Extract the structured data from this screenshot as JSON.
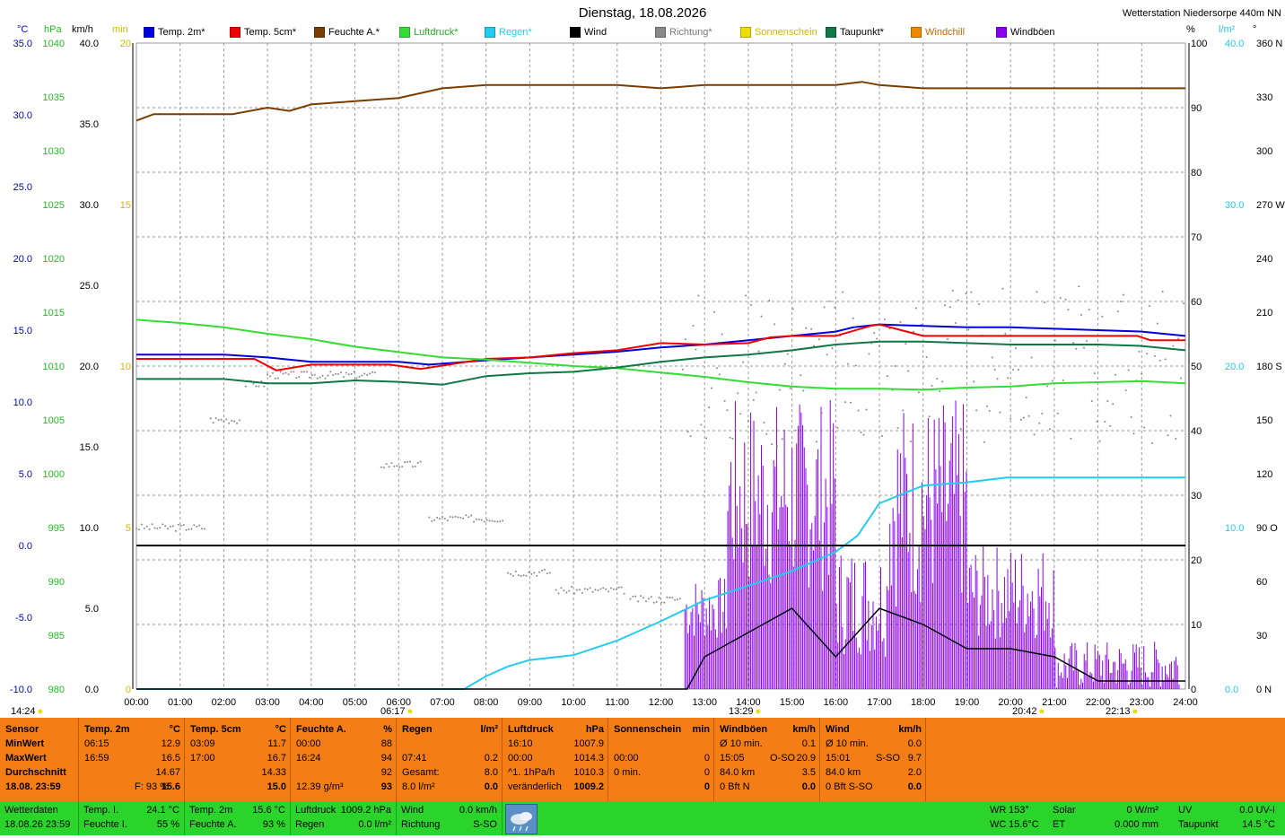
{
  "header": {
    "title": "Dienstag, 18.08.2026",
    "station": "Wetterstation Niedersorpe 440m NN"
  },
  "units": {
    "left": [
      "°C",
      "hPa",
      "km/h",
      "min"
    ],
    "right": [
      "%",
      "l/m²",
      "°"
    ]
  },
  "legend": [
    {
      "label": "Temp. 2m*",
      "color": "#0000dd"
    },
    {
      "label": "Temp. 5cm*",
      "color": "#ee0000"
    },
    {
      "label": "Feuchte A.*",
      "color": "#7a3d00"
    },
    {
      "label": "Luftdruck*",
      "color": "#33dd33"
    },
    {
      "label": "Regen*",
      "color": "#22ccee"
    },
    {
      "label": "Wind",
      "color": "#000000"
    },
    {
      "label": "Richtung*",
      "color": "#888888"
    },
    {
      "label": "Sonnenschein",
      "color": "#eedd00"
    },
    {
      "label": "Taupunkt*",
      "color": "#117744"
    },
    {
      "label": "Windchill",
      "color": "#ee8800"
    },
    {
      "label": "Windböen",
      "color": "#8800ee"
    }
  ],
  "axes": {
    "temp_ticks": [
      "35.0",
      "30.0",
      "25.0",
      "20.0",
      "15.0",
      "10.0",
      "5.0",
      "0.0",
      "-5.0",
      "-10.0"
    ],
    "hpa_ticks": [
      "1040",
      "1035",
      "1030",
      "1025",
      "1020",
      "1015",
      "1010",
      "1005",
      "1000",
      "995",
      "990",
      "985",
      "980"
    ],
    "kmh_ticks": [
      "40.0",
      "35.0",
      "30.0",
      "25.0",
      "20.0",
      "15.0",
      "10.0",
      "5.0",
      "0.0"
    ],
    "min_ticks": [
      "20",
      "15",
      "10",
      "5",
      "0"
    ],
    "pct_ticks": [
      "100",
      "90",
      "80",
      "70",
      "60",
      "50",
      "40",
      "30",
      "20",
      "10",
      "0"
    ],
    "rain_ticks": [
      "40.0",
      "30.0",
      "20.0",
      "10.0",
      "0.0"
    ],
    "deg_ticks": [
      "360 N",
      "330",
      "300",
      "270 W",
      "240",
      "210",
      "180 S",
      "150",
      "120",
      "90 O",
      "60",
      "30",
      "0 N"
    ],
    "time_ticks": [
      "00:00",
      "01:00",
      "02:00",
      "03:00",
      "04:00",
      "05:00",
      "06:00",
      "07:00",
      "08:00",
      "09:00",
      "10:00",
      "11:00",
      "12:00",
      "13:00",
      "14:00",
      "15:00",
      "16:00",
      "17:00",
      "18:00",
      "19:00",
      "20:00",
      "21:00",
      "22:00",
      "23:00",
      "24:00"
    ]
  },
  "markers": [
    {
      "label": "14:24",
      "color": "#eedd00"
    },
    {
      "label": "06:17",
      "color": "#eedd00"
    },
    {
      "label": "13:29",
      "color": "#eedd00"
    },
    {
      "label": "20:42",
      "color": "#eedd00"
    },
    {
      "label": "22:13",
      "color": "#eedd00"
    }
  ],
  "chart_data": {
    "type": "line",
    "x_unit": "hours",
    "series": [
      {
        "name": "Temp. 2m*",
        "unit": "°C",
        "x": [
          0,
          2,
          3,
          4,
          5,
          6,
          6.7,
          8,
          9,
          10,
          11,
          12,
          13,
          14,
          15,
          16,
          16.4,
          17,
          18,
          19,
          20,
          21,
          22,
          23,
          24
        ],
        "y": [
          13.3,
          13.3,
          13.1,
          12.8,
          12.8,
          12.8,
          12.6,
          12.9,
          13.1,
          13.3,
          13.5,
          13.8,
          14.0,
          14.3,
          14.6,
          14.9,
          15.2,
          15.4,
          15.3,
          15.2,
          15.2,
          15.1,
          15.0,
          14.9,
          14.6
        ]
      },
      {
        "name": "Temp. 5cm*",
        "unit": "°C",
        "x": [
          0,
          2.7,
          3.2,
          4,
          5.8,
          6.5,
          8,
          9,
          10,
          11,
          12,
          13,
          14,
          14.5,
          15,
          16,
          16.8,
          17,
          18,
          19,
          20,
          21,
          22,
          22.9,
          23.2,
          24
        ],
        "y": [
          13.0,
          13.0,
          12.2,
          12.6,
          12.6,
          12.3,
          13.0,
          13.1,
          13.4,
          13.6,
          14.1,
          14.0,
          14.1,
          14.5,
          14.6,
          14.6,
          15.3,
          15.4,
          14.6,
          14.6,
          14.6,
          14.6,
          14.6,
          14.6,
          14.3,
          14.3
        ]
      },
      {
        "name": "Feuchte A.*",
        "unit": "%",
        "x": [
          0,
          0.4,
          2.2,
          3,
          3.5,
          4,
          5,
          6,
          7,
          8,
          9,
          10,
          11,
          12,
          13,
          14,
          15,
          16,
          16.6,
          17,
          18,
          19,
          20,
          21,
          22,
          23,
          24
        ],
        "y": [
          88,
          89,
          89,
          90,
          89.5,
          90.5,
          91,
          91.5,
          93,
          93.5,
          93.5,
          93.5,
          93.5,
          93,
          93.5,
          93.5,
          93.5,
          93.5,
          94,
          93.5,
          93,
          93,
          93,
          93,
          93,
          93,
          93
        ]
      },
      {
        "name": "Luftdruck*",
        "unit": "hPa",
        "x": [
          0,
          1,
          2,
          3,
          4,
          5,
          6,
          7,
          8,
          9,
          10,
          11,
          12,
          13,
          14,
          15,
          16,
          17,
          18,
          19,
          20,
          21,
          22,
          23,
          24
        ],
        "y": [
          1014.3,
          1014.0,
          1013.6,
          1013.0,
          1012.5,
          1011.8,
          1011.3,
          1010.8,
          1010.6,
          1010.3,
          1010.0,
          1009.8,
          1009.4,
          1009.0,
          1008.5,
          1008.1,
          1007.9,
          1007.9,
          1007.8,
          1008.0,
          1008.1,
          1008.4,
          1008.5,
          1008.6,
          1008.4
        ]
      },
      {
        "name": "Regen*",
        "unit": "l/m²",
        "x": [
          0,
          7.5,
          8,
          8.5,
          9,
          10,
          11,
          12,
          13,
          14,
          15,
          16,
          16.5,
          17,
          18,
          19,
          19.9,
          20,
          21,
          22,
          23,
          24
        ],
        "y": [
          0,
          0,
          0.8,
          1.4,
          1.8,
          2.1,
          3.0,
          4.2,
          5.5,
          6.4,
          7.3,
          8.5,
          9.5,
          11.5,
          12.6,
          12.8,
          13.1,
          13.1,
          13.1,
          13.1,
          13.1,
          13.1
        ]
      },
      {
        "name": "Wind",
        "unit": "km/h",
        "x": [
          0,
          12.6,
          13,
          14,
          15,
          16,
          17,
          18,
          19,
          20,
          21,
          22,
          23,
          24
        ],
        "y": [
          0,
          0,
          2.0,
          3.5,
          5.0,
          2.0,
          5.0,
          4.0,
          2.5,
          2.5,
          2.0,
          0.5,
          0.5,
          0.5
        ]
      },
      {
        "name": "Taupunkt*",
        "unit": "°C",
        "x": [
          0,
          2,
          3,
          4,
          5,
          6,
          7,
          8,
          9,
          10,
          11,
          12,
          13,
          14,
          15,
          16,
          17,
          18,
          19,
          20,
          21,
          22,
          23,
          24
        ],
        "y": [
          11.6,
          11.6,
          11.3,
          11.3,
          11.5,
          11.4,
          11.2,
          11.8,
          12.0,
          12.1,
          12.4,
          12.8,
          13.1,
          13.3,
          13.6,
          14.0,
          14.2,
          14.2,
          14.1,
          14.0,
          14.0,
          14.0,
          13.9,
          13.6
        ]
      }
    ]
  },
  "table": {
    "columns": [
      {
        "title": "Sensor",
        "unit": "",
        "rows": [
          [
            "MinWert",
            "",
            ""
          ],
          [
            "MaxWert",
            "",
            ""
          ],
          [
            "Durchschnitt",
            "",
            ""
          ],
          [
            "18.08. 23:59",
            "",
            ""
          ]
        ]
      },
      {
        "title": "Temp. 2m",
        "unit": "°C",
        "rows": [
          [
            "06:15",
            "",
            "12.9"
          ],
          [
            "16:59",
            "",
            "16.5"
          ],
          [
            "",
            "",
            "14.67"
          ],
          [
            "",
            "F: 93 %",
            "15.6"
          ]
        ]
      },
      {
        "title": "Temp. 5cm",
        "unit": "°C",
        "rows": [
          [
            "03:09",
            "",
            "11.7"
          ],
          [
            "17:00",
            "",
            "16.7"
          ],
          [
            "",
            "",
            "14.33"
          ],
          [
            "",
            "",
            "15.0"
          ]
        ]
      },
      {
        "title": "Feuchte A.",
        "unit": "%",
        "rows": [
          [
            "00:00",
            "",
            "88"
          ],
          [
            "16:24",
            "",
            "94"
          ],
          [
            "",
            "",
            "92"
          ],
          [
            "12.39 g/m³",
            "",
            "93"
          ]
        ]
      },
      {
        "title": "Regen",
        "unit": "l/m²",
        "rows": [
          [
            "",
            "",
            ""
          ],
          [
            "07:41",
            "",
            "0.2"
          ],
          [
            "Gesamt:",
            "",
            "8.0"
          ],
          [
            "8.0 l/m²",
            "",
            "0.0"
          ]
        ]
      },
      {
        "title": "Luftdruck",
        "unit": "hPa",
        "rows": [
          [
            "16:10",
            "",
            "1007.9"
          ],
          [
            "00:00",
            "",
            "1014.3"
          ],
          [
            "^1. 1hPa/h",
            "",
            "1010.3"
          ],
          [
            "veränderlich",
            "",
            "1009.2"
          ]
        ]
      },
      {
        "title": "Sonnenschein",
        "unit": "min",
        "rows": [
          [
            "",
            "",
            ""
          ],
          [
            "00:00",
            "",
            "0"
          ],
          [
            "0 min.",
            "",
            "0"
          ],
          [
            "",
            "",
            "0"
          ]
        ]
      },
      {
        "title": "Windböen",
        "unit": "km/h",
        "rows": [
          [
            "Ø 10 min.",
            "",
            "0.1"
          ],
          [
            "15:05",
            "O-SO",
            "20.9"
          ],
          [
            "84.0 km",
            "",
            "3.5"
          ],
          [
            "0 Bft N",
            "",
            "0.0"
          ]
        ]
      },
      {
        "title": "Wind",
        "unit": "km/h",
        "rows": [
          [
            "Ø 10 min.",
            "",
            "0.0"
          ],
          [
            "15:01",
            "S-SO",
            "9.7"
          ],
          [
            "84.0 km",
            "",
            "2.0"
          ],
          [
            "0 Bft S-SO",
            "",
            "0.0"
          ]
        ]
      }
    ]
  },
  "current": {
    "label1": "Wetterdaten",
    "label2": "18.08.26 23:59",
    "items": [
      {
        "k": "Temp. I.",
        "v": "24.1 °C"
      },
      {
        "k": "Feuchte I.",
        "v": "55 %"
      },
      {
        "k": "Temp. 2m",
        "v": "15.6 °C"
      },
      {
        "k": "Feuchte A.",
        "v": "93 %"
      },
      {
        "k": "Luftdruck",
        "v": "1009.2 hPa"
      },
      {
        "k": "Regen",
        "v": "0.0 l/m²"
      },
      {
        "k": "Wind",
        "v": "0.0 km/h"
      },
      {
        "k": "Richtung",
        "v": "S-SO"
      }
    ],
    "right": [
      {
        "k": "WR",
        "v": "153°"
      },
      {
        "k": "WC",
        "v": "15.6°C"
      },
      {
        "k": "Solar",
        "v": "0 W/m²"
      },
      {
        "k": "ET",
        "v": "0.000 mm"
      },
      {
        "k": "UV",
        "v": "0.0 UV-I"
      },
      {
        "k": "Taupunkt",
        "v": "14.5 °C"
      }
    ]
  }
}
